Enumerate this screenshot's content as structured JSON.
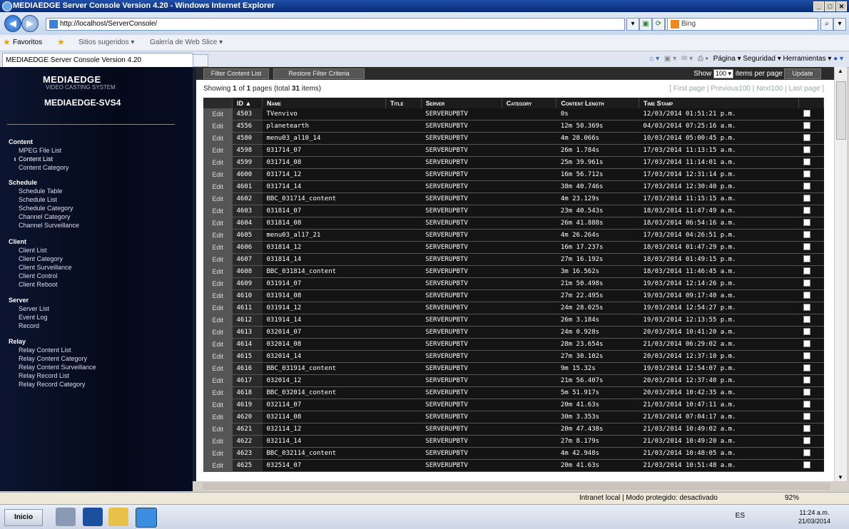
{
  "window": {
    "title": "MEDIAEDGE Server Console Version 4.20 - Windows Internet Explorer"
  },
  "address": {
    "url": "http://localhost/ServerConsole/",
    "search_placeholder": "Bing"
  },
  "favorites": {
    "label": "Favoritos",
    "sites": "Sitios sugeridos ▾",
    "gallery": "Galería de Web Slice ▾"
  },
  "tab": {
    "title": "MEDIAEDGE Server Console Version 4.20"
  },
  "commandbar": {
    "text": "Página ▾  Seguridad ▾  Herramientas ▾"
  },
  "sidebar": {
    "logo": "MEDIAEDGE",
    "logo_sub": "VIDEO CASTING SYSTEM",
    "host": "MEDIAEDGE-SVS4",
    "sections": [
      {
        "title": "Content",
        "items": [
          "MPEG File List",
          "Content List",
          "Content Category"
        ]
      },
      {
        "title": "Schedule",
        "items": [
          "Schedule Table",
          "Schedule List",
          "Schedule Category",
          "Channel Category",
          "Channel Surveillance"
        ]
      },
      {
        "title": "Client",
        "items": [
          "Client List",
          "Client Category",
          "Client Surveillance",
          "Client Control",
          "Client Reboot"
        ]
      },
      {
        "title": "Server",
        "items": [
          "Server List",
          "Event Log",
          "Record"
        ]
      },
      {
        "title": "Relay",
        "items": [
          "Relay Content List",
          "Relay Content Category",
          "Relay Content Surveillance",
          "Relay Record List",
          "Relay Record Category"
        ]
      }
    ]
  },
  "toolbar": {
    "filter_label": "Filter Content List",
    "restore_label": "Restore Filter Criteria",
    "show_label": "Show",
    "show_value": "100",
    "per_page_label": "items per page",
    "update_label": "Update"
  },
  "summary": {
    "text_pre": "Showing ",
    "page": "1",
    "text_mid": " of ",
    "pages": "1",
    "text_post": " pages (total ",
    "total": "31",
    "text_end": " items)"
  },
  "pager": "[ First page | Previous100 | Next100 | Last page ]",
  "table": {
    "headers": [
      "ID ▲",
      "Name",
      "Title",
      "Server",
      "Category",
      "Content Length",
      "Time Stamp"
    ],
    "edit_label": "Edit",
    "rows": [
      [
        "4503",
        "TVenvivo",
        "",
        "SERVERUPBTV",
        "",
        "0s",
        "12/03/2014 01:51:21 p.m."
      ],
      [
        "4556",
        "planetearth",
        "",
        "SERVERUPBTV",
        "",
        "12m 50.369s",
        "04/03/2014 07:25:16 a.m."
      ],
      [
        "4580",
        "menu03_al10_14",
        "",
        "SERVERUPBTV",
        "",
        "4m 28.066s",
        "10/03/2014 05:00:45 p.m."
      ],
      [
        "4598",
        "031714_07",
        "",
        "SERVERUPBTV",
        "",
        "26m 1.784s",
        "17/03/2014 11:13:15 a.m."
      ],
      [
        "4599",
        "031714_08",
        "",
        "SERVERUPBTV",
        "",
        "25m 39.961s",
        "17/03/2014 11:14:01 a.m."
      ],
      [
        "4600",
        "031714_12",
        "",
        "SERVERUPBTV",
        "",
        "16m 56.712s",
        "17/03/2014 12:31:14 p.m."
      ],
      [
        "4601",
        "031714_14",
        "",
        "SERVERUPBTV",
        "",
        "38m 40.746s",
        "17/03/2014 12:30:40 p.m."
      ],
      [
        "4602",
        "BBC_031714_content",
        "",
        "SERVERUPBTV",
        "",
        "4m 23.129s",
        "17/03/2014 11:15:15 a.m."
      ],
      [
        "4603",
        "031814_07",
        "",
        "SERVERUPBTV",
        "",
        "23m 40.543s",
        "18/03/2014 11:47:49 a.m."
      ],
      [
        "4604",
        "031814_08",
        "",
        "SERVERUPBTV",
        "",
        "26m 41.888s",
        "18/03/2014 06:54:16 a.m."
      ],
      [
        "4605",
        "menu03_al17_21",
        "",
        "SERVERUPBTV",
        "",
        "4m 26.264s",
        "17/03/2014 04:26:51 p.m."
      ],
      [
        "4606",
        "031814_12",
        "",
        "SERVERUPBTV",
        "",
        "16m 17.237s",
        "18/03/2014 01:47:29 p.m."
      ],
      [
        "4607",
        "031814_14",
        "",
        "SERVERUPBTV",
        "",
        "27m 16.192s",
        "18/03/2014 01:49:15 p.m."
      ],
      [
        "4608",
        "BBC_031814_content",
        "",
        "SERVERUPBTV",
        "",
        "3m 16.562s",
        "18/03/2014 11:46:45 a.m."
      ],
      [
        "4609",
        "031914_07",
        "",
        "SERVERUPBTV",
        "",
        "21m 50.498s",
        "19/03/2014 12:14:26 p.m."
      ],
      [
        "4610",
        "031914_08",
        "",
        "SERVERUPBTV",
        "",
        "27m 22.495s",
        "19/03/2014 09:17:40 a.m."
      ],
      [
        "4611",
        "031914_12",
        "",
        "SERVERUPBTV",
        "",
        "24m 28.025s",
        "19/03/2014 12:54:27 p.m."
      ],
      [
        "4612",
        "031914_14",
        "",
        "SERVERUPBTV",
        "",
        "26m 3.184s",
        "19/03/2014 12:13:55 p.m."
      ],
      [
        "4613",
        "032014_07",
        "",
        "SERVERUPBTV",
        "",
        "24m 0.928s",
        "20/03/2014 10:41:20 a.m."
      ],
      [
        "4614",
        "032014_08",
        "",
        "SERVERUPBTV",
        "",
        "28m 23.654s",
        "21/03/2014 06:29:02 a.m."
      ],
      [
        "4615",
        "032014_14",
        "",
        "SERVERUPBTV",
        "",
        "27m 30.102s",
        "20/03/2014 12:37:10 p.m."
      ],
      [
        "4616",
        "BBC_031914_content",
        "",
        "SERVERUPBTV",
        "",
        "9m 15.32s",
        "19/03/2014 12:54:07 p.m."
      ],
      [
        "4617",
        "032014_12",
        "",
        "SERVERUPBTV",
        "",
        "21m 56.407s",
        "20/03/2014 12:37:40 p.m."
      ],
      [
        "4618",
        "BBC_032014_content",
        "",
        "SERVERUPBTV",
        "",
        "5m 51.917s",
        "20/03/2014 10:42:35 a.m."
      ],
      [
        "4619",
        "032114_07",
        "",
        "SERVERUPBTV",
        "",
        "20m 41.63s",
        "21/03/2014 10:47:11 a.m."
      ],
      [
        "4620",
        "032114_08",
        "",
        "SERVERUPBTV",
        "",
        "30m 3.353s",
        "21/03/2014 07:04:17 a.m."
      ],
      [
        "4621",
        "032114_12",
        "",
        "SERVERUPBTV",
        "",
        "20m 47.438s",
        "21/03/2014 10:49:02 a.m."
      ],
      [
        "4622",
        "032114_14",
        "",
        "SERVERUPBTV",
        "",
        "27m 8.179s",
        "21/03/2014 10:49:20 a.m."
      ],
      [
        "4623",
        "BBC_032114_content",
        "",
        "SERVERUPBTV",
        "",
        "4m 42.948s",
        "21/03/2014 10:48:05 a.m."
      ],
      [
        "4625",
        "032514_07",
        "",
        "SERVERUPBTV",
        "",
        "20m 41.63s",
        "21/03/2014 10:51:48 a.m."
      ]
    ]
  },
  "statusbar": {
    "zone": "Intranet local | Modo protegido: desactivado",
    "zoom": "92%"
  },
  "taskbar": {
    "start": "Inicio",
    "lang": "ES",
    "time": "11:24 a.m.",
    "date": "21/03/2014"
  }
}
